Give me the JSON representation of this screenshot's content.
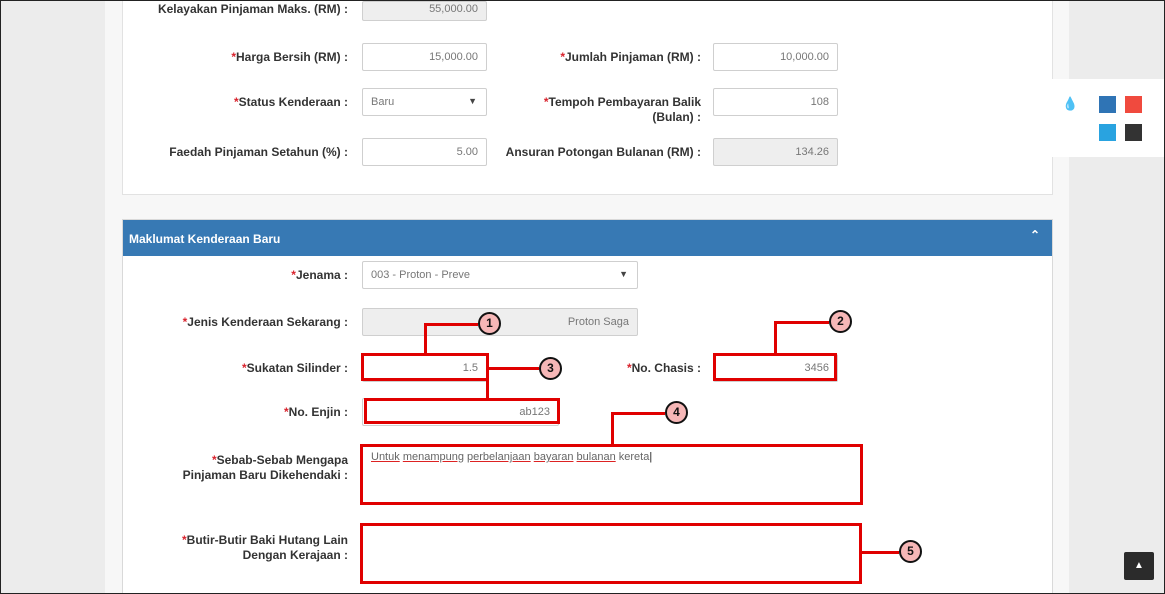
{
  "panel1": {
    "max_eligibility": {
      "label": "Kelayakan Pinjaman Maks. (RM) :",
      "value": "55,000.00"
    },
    "net_price": {
      "label": "Harga Bersih (RM) :",
      "value": "15,000.00"
    },
    "loan_amount": {
      "label": "Jumlah Pinjaman (RM) :",
      "value": "10,000.00"
    },
    "vehicle_status": {
      "label": "Status Kenderaan :",
      "value": "Baru"
    },
    "repayment_period": {
      "label": "Tempoh Pembayaran Balik (Bulan) :",
      "value": "108"
    },
    "interest_rate": {
      "label": "Faedah Pinjaman Setahun (%) :",
      "value": "5.00"
    },
    "monthly_installment": {
      "label": "Ansuran Potongan Bulanan (RM) :",
      "value": "134.26"
    }
  },
  "panel2": {
    "title": "Maklumat Kenderaan Baru",
    "brand": {
      "label": "Jenama :",
      "value": "003 - Proton - Preve"
    },
    "current_vehicle_type": {
      "label": "Jenis Kenderaan Sekarang :",
      "value": "Proton Saga"
    },
    "engine_capacity": {
      "label": "Sukatan Silinder :",
      "value": "1.5"
    },
    "chassis_no": {
      "label": "No. Chasis :",
      "value": "3456"
    },
    "engine_no": {
      "label": "No. Enjin :",
      "value": "ab123"
    },
    "reason": {
      "label_line1": "Sebab-Sebab Mengapa",
      "label_line2": "Pinjaman Baru Dikehendaki :",
      "words": [
        "Untuk",
        "menampung",
        "perbelanjaan",
        "bayaran",
        "bulanan",
        "kereta"
      ]
    },
    "other_debts": {
      "label_line1": "Butir-Butir Baki Hutang Lain",
      "label_line2": "Dengan Kerajaan :",
      "value": ""
    }
  },
  "required_mark": "*",
  "callouts": [
    "1",
    "2",
    "3",
    "4",
    "5"
  ],
  "theme_colors": [
    "#2f74b5",
    "#f04a3e",
    "#29a3e0",
    "#333333"
  ],
  "icons": {
    "theme": "water-drop-icon",
    "scroll_top": "chevron-up-icon",
    "collapse": "chevron-up-icon",
    "dropdown": "caret-down-icon"
  }
}
